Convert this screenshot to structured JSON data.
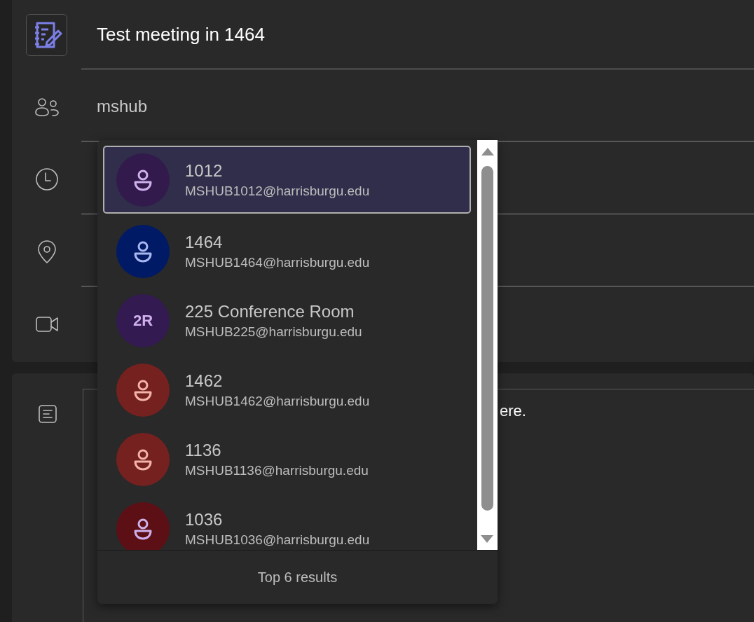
{
  "title_field": {
    "value": "Test meeting in 1464"
  },
  "attendees_field": {
    "value": "mshub"
  },
  "details_editor": {
    "visible_text": "ere."
  },
  "suggestions": {
    "items": [
      {
        "name": "1012",
        "email": "MSHUB1012@harrisburgu.edu",
        "selected": true,
        "color": "#321a4d",
        "avatar": {
          "kind": "icon"
        }
      },
      {
        "name": "1464",
        "email": "MSHUB1464@harrisburgu.edu",
        "selected": false,
        "color": "#001a66",
        "avatar": {
          "kind": "icon"
        }
      },
      {
        "name": "225 Conference Room",
        "email": "MSHUB225@harrisburgu.edu",
        "selected": false,
        "color": "#331a50",
        "avatar": {
          "kind": "initials",
          "initials": "2R"
        }
      },
      {
        "name": "1462",
        "email": "MSHUB1462@harrisburgu.edu",
        "selected": false,
        "color": "#752120",
        "avatar": {
          "kind": "icon"
        }
      },
      {
        "name": "1136",
        "email": "MSHUB1136@harrisburgu.edu",
        "selected": false,
        "color": "#752120",
        "avatar": {
          "kind": "icon"
        }
      },
      {
        "name": "1036",
        "email": "MSHUB1036@harrisburgu.edu",
        "selected": false,
        "color": "#5c1016",
        "avatar": {
          "kind": "icon"
        }
      }
    ],
    "footer": "Top 6 results"
  }
}
